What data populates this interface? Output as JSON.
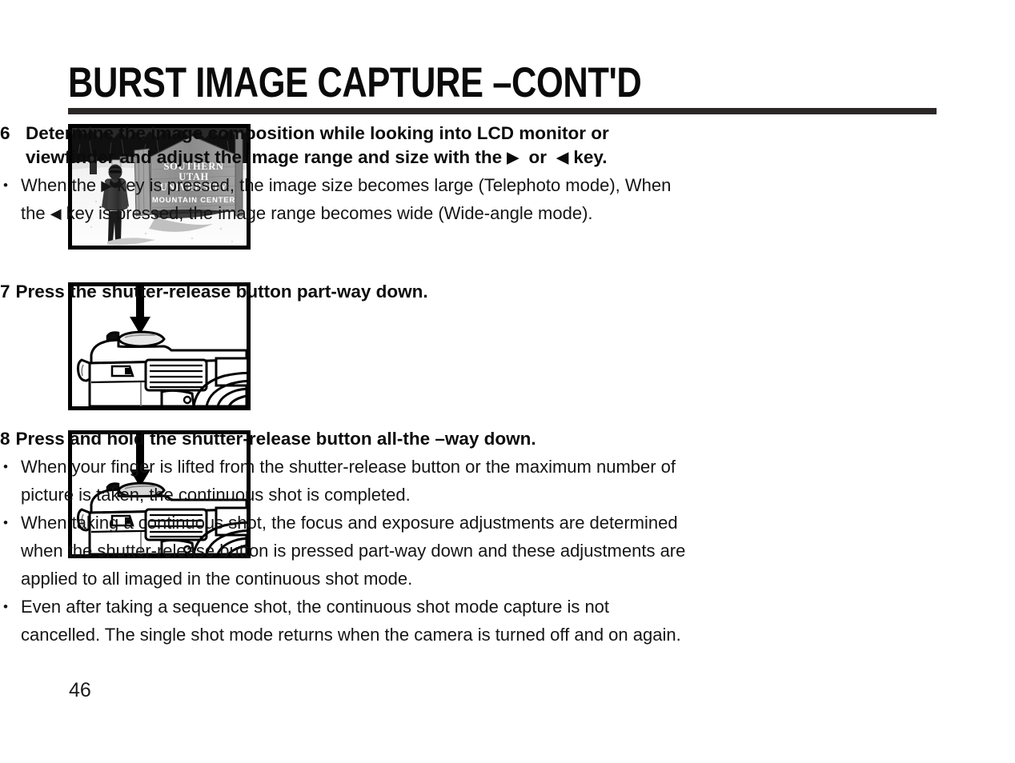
{
  "document": {
    "title": "BURST IMAGE CAPTURE –CONT'D",
    "page_number": "46"
  },
  "figures": {
    "photo": {
      "name": "snow-sign-photograph",
      "alt": "Black and white photo of a person standing in snow beside a wooden sign",
      "sign_lines": [
        "SOUTHERN",
        "UTAH",
        "UNIVERSITY"
      ],
      "sign_subtitle": "MOUNTAIN CENTER"
    },
    "camera_step7": {
      "name": "camera-shutter-part-way-diagram",
      "alt": "Line drawing of a camera with an arrow pointing down at the shutter-release button"
    },
    "camera_step8": {
      "name": "camera-shutter-all-the-way-diagram",
      "alt": "Line drawing of a camera with an arrow pointing down at the shutter-release button"
    }
  },
  "steps": [
    {
      "number": "6",
      "heading_part_1": "Determine the image composition while looking into LCD monitor or viewfinder and adjust the image range and size with the ",
      "heading_key_right": "▶",
      "heading_mid": "  or  ",
      "heading_key_left": "◀",
      "heading_part_2": " key.",
      "bullets": [
        {
          "text_1": "When the ",
          "key_1": "▶",
          "text_2": " key is pressed, the image size becomes large (Telephoto mode), When the ",
          "key_2": "◀",
          "text_3": " key is pressed, the image range becomes wide (Wide-angle mode)."
        }
      ]
    },
    {
      "number": "7",
      "heading": "Press the shutter-release button part-way down.",
      "bullets": []
    },
    {
      "number": "8",
      "heading": "Press and hold the shutter-release button all-the –way down.",
      "bullets": [
        {
          "text": "When your finger is lifted from the shutter-release button or the maximum number of picture is taken, the continuous shot is completed."
        },
        {
          "text": "When taking a continuous shot, the focus and exposure adjustments are determined when the shutter-release button is pressed part-way down and these adjustments are applied to all imaged in the continuous shot mode."
        },
        {
          "text": "Even after taking a sequence shot, the continuous shot mode capture is not cancelled. The single shot mode returns when the camera is turned off and on again."
        }
      ]
    }
  ],
  "colors": {
    "ink": "#111111",
    "rule": "#2a2726",
    "page_background": "#ffffff"
  }
}
